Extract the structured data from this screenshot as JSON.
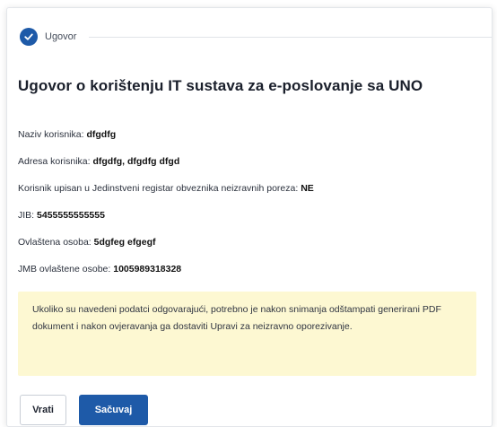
{
  "step": {
    "label": "Ugovor",
    "icon": "checkmark-icon",
    "icon_color": "#1e5aa8"
  },
  "title": "Ugovor o korištenju IT sustava za e-poslovanje sa UNO",
  "fields": [
    {
      "label": "Naziv korisnika:",
      "value": "dfgdfg"
    },
    {
      "label": "Adresa korisnika:",
      "value": "dfgdfg, dfgdfg dfgd"
    },
    {
      "label": "Korisnik upisan u Jedinstveni registar obveznika neizravnih poreza:",
      "value": "NE"
    },
    {
      "label": "JIB:",
      "value": "5455555555555"
    },
    {
      "label": "Ovlaštena osoba:",
      "value": "5dgfeg efgegf"
    },
    {
      "label": "JMB ovlaštene osobe:",
      "value": "1005989318328"
    }
  ],
  "notice": {
    "text": "Ukoliko su navedeni podatci odgovarajući, potrebno je nakon snimanja odštampati generirani PDF dokument i nakon ovjeravanja ga dostaviti Upravi za neizravno oporezivanje.",
    "background": "#fdf8d2"
  },
  "buttons": {
    "back_label": "Vrati",
    "save_label": "Sačuvaj",
    "primary_color": "#1e5aa8"
  }
}
